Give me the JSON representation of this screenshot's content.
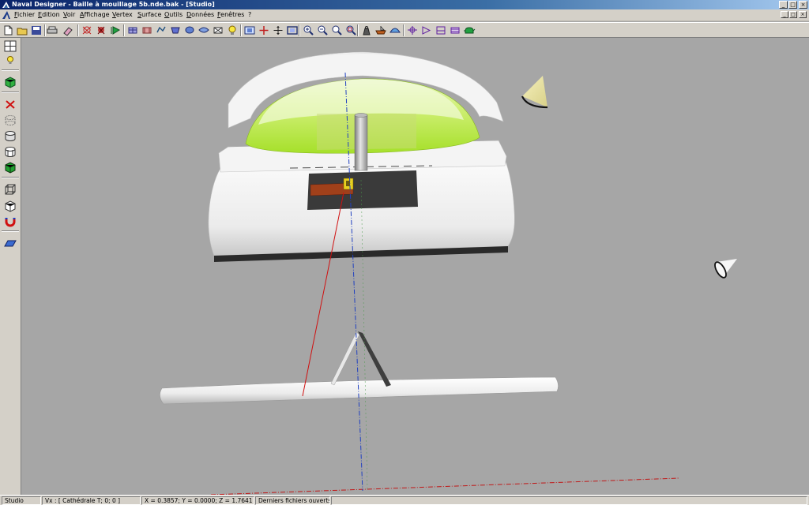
{
  "window": {
    "title": "Naval Designer - Baille à mouillage 5b.nde.bak - [Studio]",
    "controls": {
      "minimize": "_",
      "maximize": "□",
      "close": "×"
    }
  },
  "menu": {
    "items": [
      "Fichier",
      "Edition",
      "Voir",
      "Affichage",
      "Vertex",
      "Surface",
      "Outils",
      "Données",
      "Fenêtres",
      "?"
    ]
  },
  "statusbar": {
    "mode": "Studio",
    "vertex": "Vx : [ Cathédrale T; 0; 0 ]",
    "coords": "X = 0.3857; Y = 0.0000; Z = 1.7641",
    "hint": "Derniers fichiers ouverts"
  },
  "colors": {
    "titlebar_start": "#0a246a",
    "chrome": "#d4d0c8",
    "viewport_bg": "#a6a6a6",
    "dome_green": "#b6ea3a",
    "hull_white": "#f0f0f0",
    "light_cone": "#e8e29a",
    "axis_red": "#d01010",
    "axis_blue": "#2040c0",
    "deck_panel": "#3a3a3a",
    "orange_panel": "#a0401a",
    "yellow_part": "#e8d020"
  },
  "toolbar_icons": [
    "new-file-icon",
    "open-file-icon",
    "save-file-icon",
    "print-icon",
    "eraser-icon",
    "vertex-select-icon",
    "vertex-weld-icon",
    "vertex-play-icon",
    "surface-a-icon",
    "surface-b-icon",
    "surface-c-icon",
    "surface-d-icon",
    "surface-e-icon",
    "surface-f-icon",
    "surface-g-icon",
    "light-bulb-icon",
    "view-fit-icon",
    "view-move-icon",
    "view-pan-icon",
    "view-frame-icon",
    "zoom-in-icon",
    "zoom-minus-icon",
    "zoom-out-icon",
    "zoom-window-icon",
    "hydro-weight-icon",
    "hydro-boat-icon",
    "hydro-dome-icon",
    "section-a-icon",
    "section-b-icon",
    "section-c-icon",
    "section-d-icon",
    "render-teapot-icon"
  ],
  "left_icons": [
    "grid-icon",
    "light-icon",
    "green-cube-icon",
    "delete-icon",
    "dotted-cylinder-icon",
    "cylinder-icon",
    "cylinder-outline-icon",
    "green-box-icon",
    "wire-cube-icon",
    "wire-box-icon",
    "magnet-icon",
    "plane-icon"
  ]
}
